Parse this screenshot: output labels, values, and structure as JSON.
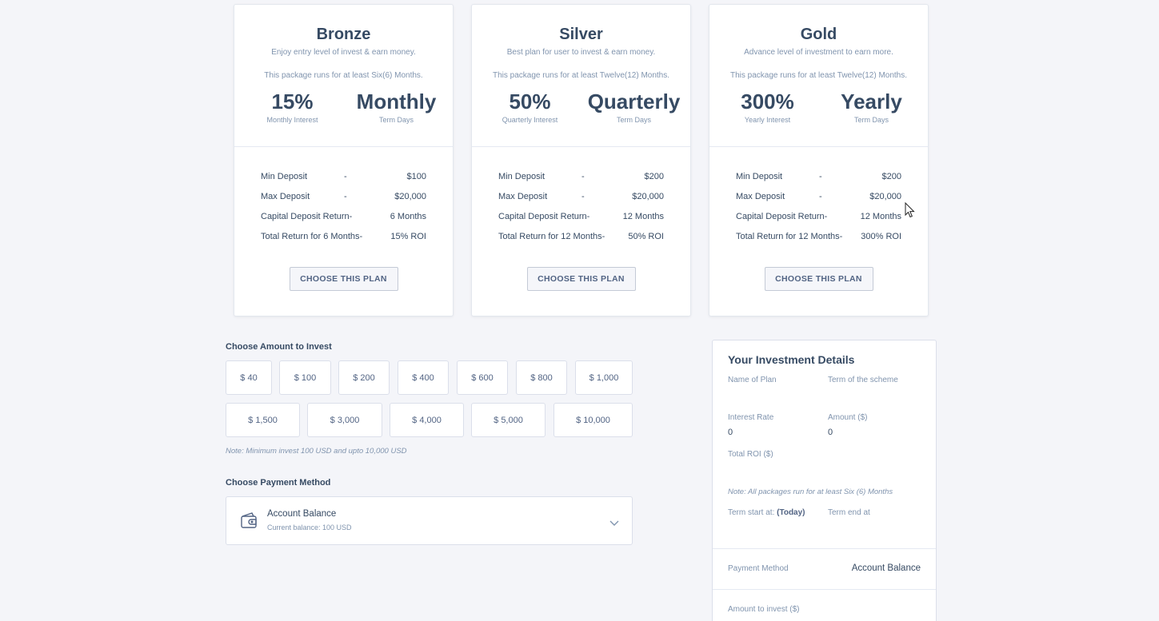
{
  "plans": [
    {
      "name": "Bronze",
      "description": "Enjoy entry level of invest & earn money.",
      "runs": "This package runs for at least Six(6) Months.",
      "interest_value": "15%",
      "interest_label": "Monthly Interest",
      "term_value": "Monthly",
      "term_label": "Term Days",
      "rows": [
        {
          "label": "Min Deposit",
          "sep": "-",
          "value": "$100"
        },
        {
          "label": "Max Deposit",
          "sep": "-",
          "value": "$20,000"
        },
        {
          "label": "Capital Deposit Return-",
          "sep": "",
          "value": "6 Months"
        },
        {
          "label": "Total Return for 6 Months-",
          "sep": "",
          "value": "15% ROI"
        }
      ],
      "button": "CHOOSE THIS PLAN"
    },
    {
      "name": "Silver",
      "description": "Best plan for user to invest & earn money.",
      "runs": "This package runs for at least Twelve(12) Months.",
      "interest_value": "50%",
      "interest_label": "Quarterly Interest",
      "term_value": "Quarterly",
      "term_label": "Term Days",
      "rows": [
        {
          "label": "Min Deposit",
          "sep": "-",
          "value": "$200"
        },
        {
          "label": "Max Deposit",
          "sep": "-",
          "value": "$20,000"
        },
        {
          "label": "Capital Deposit Return-",
          "sep": "",
          "value": "12 Months"
        },
        {
          "label": "Total Return for 12 Months-",
          "sep": "",
          "value": "50% ROI"
        }
      ],
      "button": "CHOOSE THIS PLAN"
    },
    {
      "name": "Gold",
      "description": "Advance level of investment to earn more.",
      "runs": "This package runs for at least Twelve(12) Months.",
      "interest_value": "300%",
      "interest_label": "Yearly Interest",
      "term_value": "Yearly",
      "term_label": "Term Days",
      "rows": [
        {
          "label": "Min Deposit",
          "sep": "-",
          "value": "$200"
        },
        {
          "label": "Max Deposit",
          "sep": "-",
          "value": "$20,000"
        },
        {
          "label": "Capital Deposit Return-",
          "sep": "",
          "value": "12 Months"
        },
        {
          "label": "Total Return for 12 Months-",
          "sep": "",
          "value": "300% ROI"
        }
      ],
      "button": "CHOOSE THIS PLAN"
    }
  ],
  "amount": {
    "title": "Choose Amount to Invest",
    "options": [
      "$ 40",
      "$ 100",
      "$ 200",
      "$ 400",
      "$ 600",
      "$ 800",
      "$ 1,000",
      "$ 1,500",
      "$ 3,000",
      "$ 4,000",
      "$ 5,000",
      "$ 10,000"
    ],
    "note": "Note: Minimum invest 100 USD and upto 10,000 USD"
  },
  "payment": {
    "title": "Choose Payment Method",
    "method": "Account Balance",
    "balance": "Current balance: 100 USD"
  },
  "details": {
    "title": "Your Investment Details",
    "name_of_plan_label": "Name of Plan",
    "term_label": "Term of the scheme",
    "interest_rate_label": "Interest Rate",
    "interest_rate_value": "0",
    "amount_label": "Amount ($)",
    "amount_value": "0",
    "total_roi_label": "Total ROI ($)",
    "note": "Note: All packages run for at least Six (6) Months",
    "term_start_label": "Term start at:",
    "term_start_today": "(Today)",
    "term_end_label": "Term end at",
    "payment_method_label": "Payment Method",
    "payment_method_value": "Account Balance",
    "amount_to_invest_label": "Amount to invest ($)"
  }
}
